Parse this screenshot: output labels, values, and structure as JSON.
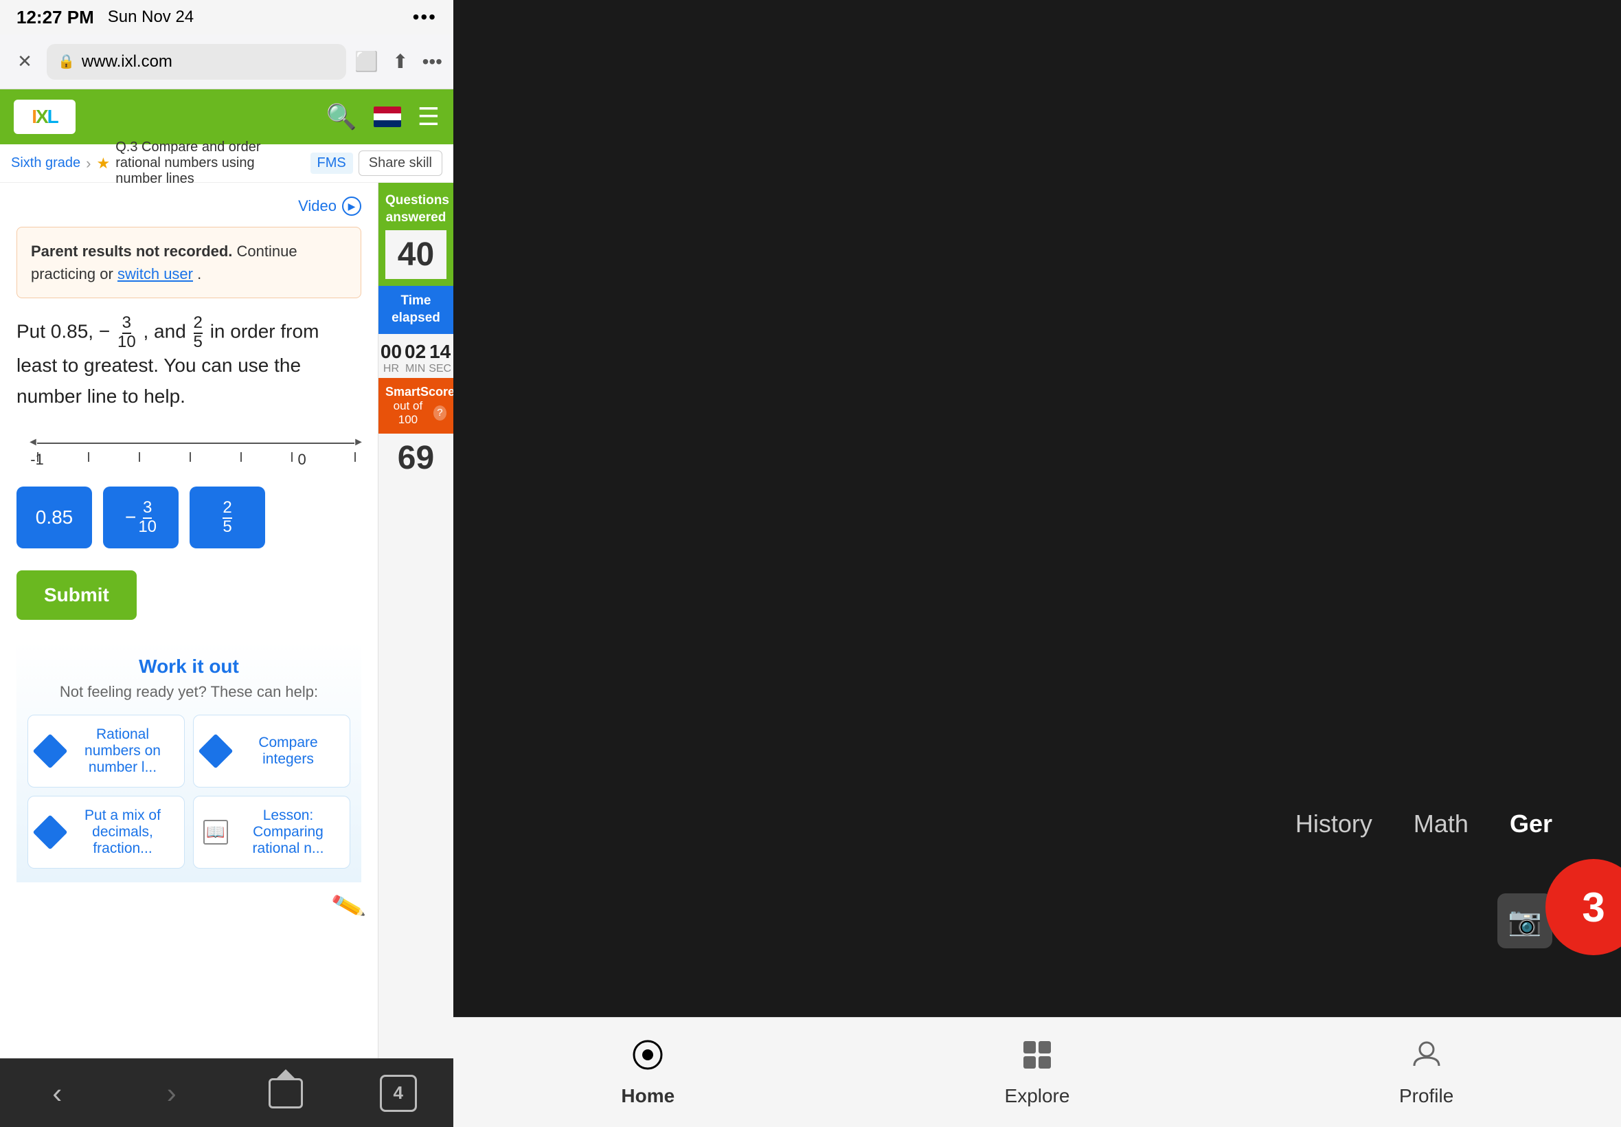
{
  "statusBar": {
    "time": "12:27 PM",
    "date": "Sun Nov 24",
    "dots": "•••"
  },
  "browser": {
    "url": "www.ixl.com",
    "closeLabel": "✕",
    "bookmarkIcon": "⬜",
    "shareIcon": "⬆",
    "moreIcon": "•••"
  },
  "ixlHeader": {
    "logoI": "I",
    "logoX": "X",
    "logoL": "L",
    "searchIcon": "🔍",
    "menuIcon": "☰"
  },
  "breadcrumb": {
    "grade": "Sixth grade",
    "chevron": "›",
    "starIcon": "★",
    "skillCode": "Q.3",
    "skillName": "Compare and order rational numbers using number lines",
    "fmsBadge": "FMS",
    "shareSkill": "Share skill"
  },
  "videoButton": {
    "label": "Video"
  },
  "parentNotice": {
    "boldText": "Parent results not recorded.",
    "text": " Continue practicing or ",
    "linkText": "switch user",
    "endText": "."
  },
  "question": {
    "text1": "Put 0.85, −",
    "frac1Num": "3",
    "frac1Den": "10",
    "text2": ", and ",
    "frac2Num": "2",
    "frac2Den": "5",
    "text3": " in order from least to greatest. You can use the number line to help.",
    "numberLine": {
      "minLabel": "-1",
      "maxLabel": "0"
    }
  },
  "answerChips": [
    {
      "id": "chip1",
      "label": "0.85",
      "type": "decimal"
    },
    {
      "id": "chip2",
      "negSign": "−",
      "fracNum": "3",
      "fracDen": "10",
      "type": "fraction"
    },
    {
      "id": "chip3",
      "fracNum": "2",
      "fracDen": "5",
      "type": "fraction"
    }
  ],
  "submitButton": {
    "label": "Submit"
  },
  "workItOut": {
    "title": "Work it out",
    "subtitle": "Not feeling ready yet? These can help:",
    "helpItems": [
      {
        "id": "help1",
        "text": "Rational numbers on number l...",
        "type": "diamond"
      },
      {
        "id": "help2",
        "text": "Compare integers",
        "type": "diamond"
      },
      {
        "id": "help3",
        "text": "Put a mix of decimals, fraction...",
        "type": "diamond"
      },
      {
        "id": "help4",
        "text": "Lesson: Comparing rational n...",
        "type": "book"
      }
    ]
  },
  "sidebar": {
    "questionsAnsweredLabel": "Questions answered",
    "questionsAnsweredCount": "40",
    "timeElapsedLabel": "Time elapsed",
    "timeHr": "00",
    "timeMin": "02",
    "timeSec": "14",
    "hrLabel": "HR",
    "minLabel": "MIN",
    "secLabel": "SEC",
    "smartScoreLabel": "SmartScore",
    "smartScoreOutOf": "out of 100",
    "smartScoreValue": "69"
  },
  "browserNav": {
    "backLabel": "‹",
    "forwardLabel": "›",
    "tabsCount": "4"
  },
  "rightPanel": {
    "subjectHistory": "History",
    "subjectMath": "Math",
    "subjectGer": "Ger",
    "redCircleNum": "3"
  },
  "appNav": {
    "homeIcon": "⊙",
    "homeLabel": "Home",
    "exploreIcon": "⠿",
    "exploreLabel": "Explore",
    "profileIcon": "☺",
    "profileLabel": "Profile"
  }
}
